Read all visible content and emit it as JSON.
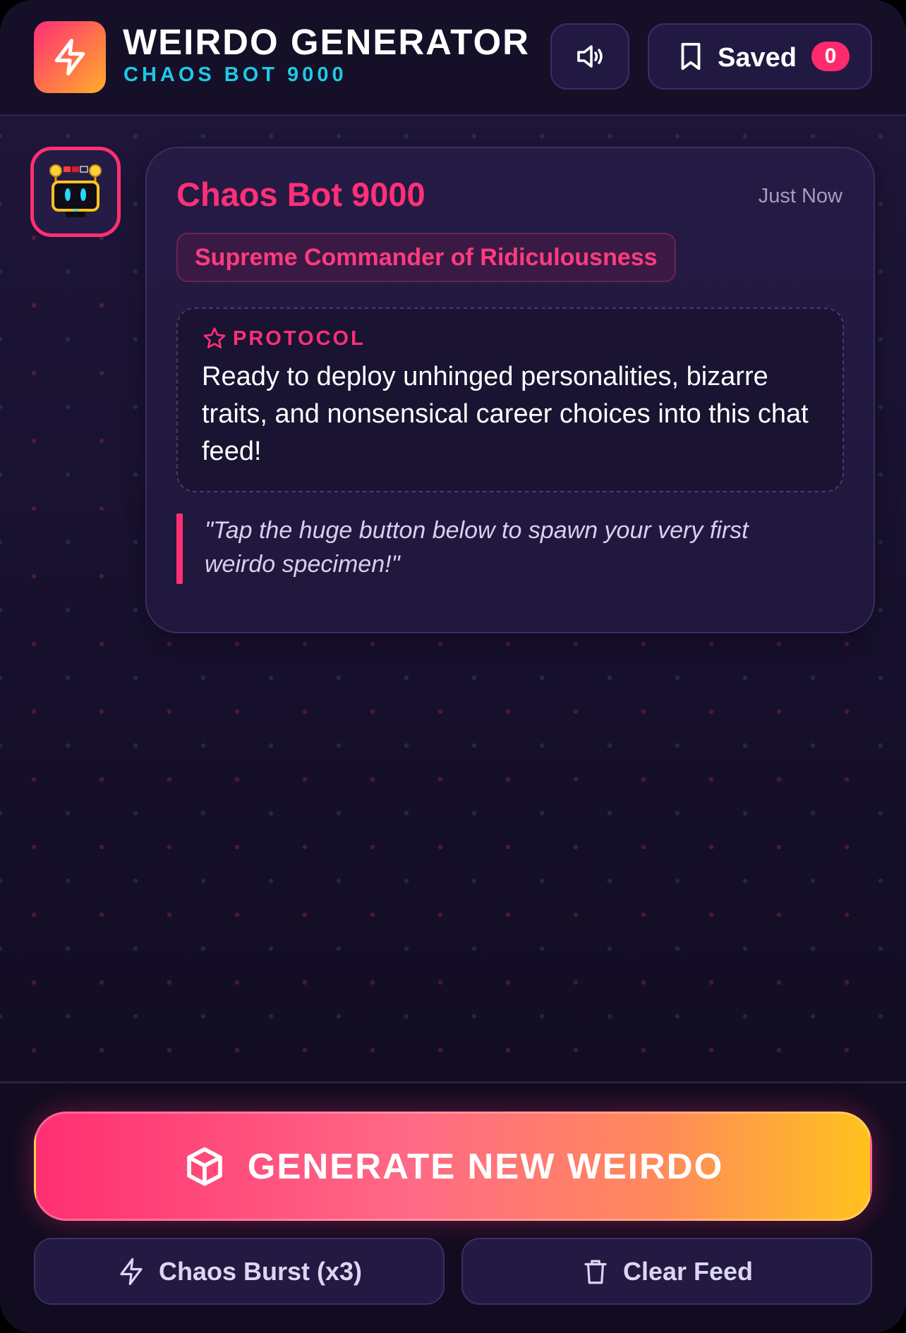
{
  "header": {
    "title": "WEIRDO GENERATOR",
    "subtitle": "CHAOS BOT 9000",
    "logo_icon": "lightning-icon",
    "sound_icon": "speaker-icon",
    "saved_label": "Saved",
    "saved_count": "0"
  },
  "message": {
    "author": "Chaos Bot 9000",
    "timestamp": "Just Now",
    "role": "Supreme Commander of Ridiculousness",
    "protocol_label": "PROTOCOL",
    "protocol_text": "Ready to deploy unhinged personalities, bizarre traits, and nonsensical career choices into this chat feed!",
    "quote": "\"Tap the huge button below to spawn your very first weirdo specimen!\""
  },
  "actions": {
    "generate_label": "GENERATE NEW WEIRDO",
    "burst_label": "Chaos Burst (x3)",
    "clear_label": "Clear Feed"
  },
  "colors": {
    "accent_pink": "#ff2f72",
    "accent_cyan": "#1ec9e6",
    "accent_orange": "#ffc21e",
    "background": "#130d24"
  }
}
